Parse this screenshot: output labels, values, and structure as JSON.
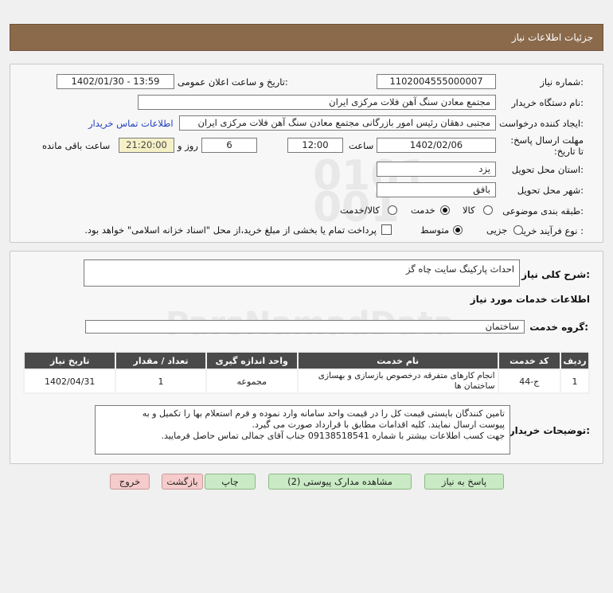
{
  "header": {
    "title": "جزئیات اطلاعات نیاز"
  },
  "form": {
    "need_number_label": "شماره نیاز:",
    "need_number": "1102004555000007",
    "announce_label": "تاریخ و ساعت اعلان عمومی:",
    "announce_value": "1402/01/30 - 13:59",
    "buyer_org_label": "نام دستگاه خریدار:",
    "buyer_org": "مجتمع معادن سنگ آهن فلات مرکزی ایران",
    "requester_label": "ایجاد کننده درخواست:",
    "requester": "مجتبی  دهقان رئیس امور بازرگانی مجتمع معادن سنگ آهن فلات مرکزی ایران",
    "contact_link": "اطلاعات تماس خریدار",
    "deadline_label": "مهلت ارسال پاسخ: تا تاریخ:",
    "deadline_date": "1402/02/06",
    "time_label": "ساعت",
    "deadline_time": "12:00",
    "days_value": "6",
    "days_label": "روز و",
    "remaining_time": "21:20:00",
    "remaining_label": "ساعت باقی مانده",
    "province_label": "استان محل تحویل:",
    "province": "یزد",
    "city_label": "شهر محل تحویل:",
    "city": "بافق",
    "category_label": "طبقه بندی موضوعی:",
    "category_options": [
      "کالا",
      "خدمت",
      "کالا/خدمت"
    ],
    "category_selected": "خدمت",
    "process_label": "نوع فرآیند خرید :",
    "process_options": [
      "جزیی",
      "متوسط"
    ],
    "process_selected": "متوسط",
    "payment_note": "پرداخت تمام یا بخشی از مبلغ خرید،از محل \"اسناد خزانه اسلامی\" خواهد بود."
  },
  "details": {
    "summary_label": "شرح کلی نیاز:",
    "summary": "احداث پارکینگ سایت چاه گز",
    "services_title": "اطلاعات خدمات مورد نیاز",
    "service_group_label": "گروه خدمت:",
    "service_group": "ساختمان",
    "table": {
      "headers": [
        "ردیف",
        "کد خدمت",
        "نام خدمت",
        "واحد اندازه گیری",
        "تعداد / مقدار",
        "تاریخ نیاز"
      ],
      "rows": [
        [
          "1",
          "ج-44",
          "انجام کارهای متفرقه درخصوص بازسازی و بهسازی ساختمان ها",
          "مجموعه",
          "1",
          "1402/04/31"
        ]
      ]
    },
    "buyer_notes_label": "توضیحات خریدار:",
    "buyer_notes_line1": "تامین کنندگان بایستی قیمت کل را در قیمت واحد سامانه وارد نموده و فرم استعلام بها را تکمیل و به",
    "buyer_notes_line2": "پیوست ارسال نمایند. کلیه اقدامات مطابق با قرارداد صورت می گیرد.",
    "buyer_notes_line3": "جهت کسب اطلاعات بیشتر با شماره 09138518541 جناب آقای جمالی تماس حاصل فرمایید."
  },
  "buttons": {
    "reply": "پاسخ به نیاز",
    "attachments": "مشاهده مدارک پیوستی (2)",
    "print": "چاپ",
    "back": "بازگشت",
    "exit": "خروج"
  },
  "colors": {
    "header_bg": "#8b6a4c",
    "table_header_bg": "#4a4a4a",
    "green_button": "#c9eac4",
    "pink_button": "#f6cbcb",
    "link": "#1f3fbf"
  }
}
